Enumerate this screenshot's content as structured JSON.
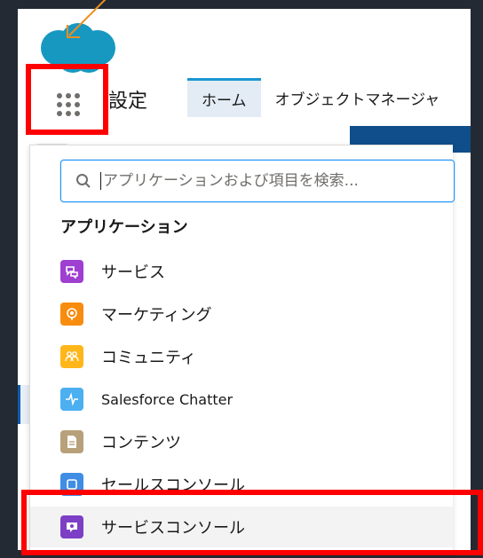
{
  "header": {
    "setup_title": "設定",
    "tabs": [
      {
        "label": "ホーム",
        "active": true
      },
      {
        "label": "オブジェクトマネージャ",
        "active": false
      }
    ]
  },
  "launcher": {
    "search_placeholder": "アプリケーションおよび項目を検索...",
    "search_value": "",
    "section_title": "アプリケーション",
    "apps": [
      {
        "label": "サービス",
        "icon": "service-icon",
        "color": "#9e3fd1"
      },
      {
        "label": "マーケティング",
        "icon": "marketing-icon",
        "color": "#f88c0f"
      },
      {
        "label": "コミュニティ",
        "icon": "community-icon",
        "color": "#ffb61a"
      },
      {
        "label": "Salesforce Chatter",
        "icon": "chatter-icon",
        "color": "#4baff0"
      },
      {
        "label": "コンテンツ",
        "icon": "content-icon",
        "color": "#b7a07a"
      },
      {
        "label": "セールスコンソール",
        "icon": "sales-console-icon",
        "color": "#3f8ee4"
      },
      {
        "label": "サービスコンソール",
        "icon": "service-console-icon",
        "color": "#7c3fc5",
        "selected": true
      }
    ]
  },
  "colors": {
    "annotation_red": "#ff0000",
    "annotation_arrow": "#ee8f1f",
    "accent_blue": "#1b96ff",
    "salesforce_cloud": "#1798c1"
  }
}
